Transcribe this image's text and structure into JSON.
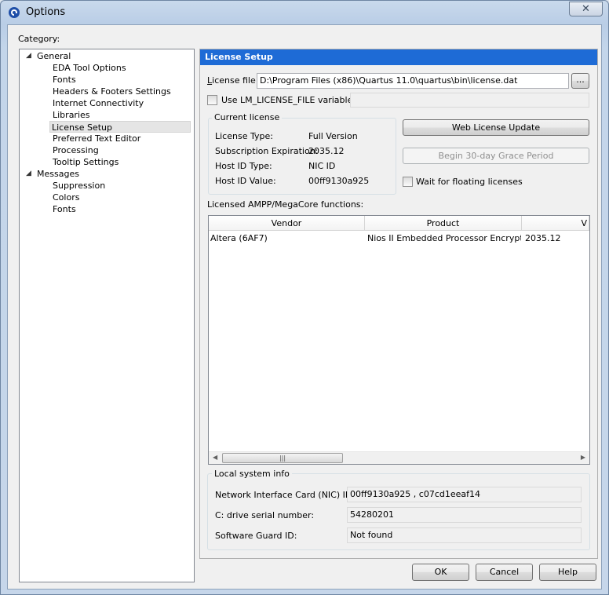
{
  "window": {
    "title": "Options",
    "close_glyph": "✕"
  },
  "category_label": "Category:",
  "tree": [
    {
      "label": "General",
      "expanded": true
    },
    {
      "label": "EDA Tool Options"
    },
    {
      "label": "Fonts"
    },
    {
      "label": "Headers & Footers Settings"
    },
    {
      "label": "Internet Connectivity"
    },
    {
      "label": "Libraries"
    },
    {
      "label": "License Setup",
      "selected": true
    },
    {
      "label": "Preferred Text Editor"
    },
    {
      "label": "Processing"
    },
    {
      "label": "Tooltip Settings"
    },
    {
      "label": "Messages",
      "expanded": true
    },
    {
      "label": "Suppression"
    },
    {
      "label": "Colors"
    },
    {
      "label": "Fonts"
    }
  ],
  "panel": {
    "header": "License Setup",
    "license_file_label_first": "L",
    "license_file_label_rest": "icense file:",
    "license_file_value": "D:\\Program Files (x86)\\Quartus 11.0\\quartus\\bin\\license.dat",
    "browse_label": "...",
    "use_lm_label": "Use LM_LICENSE_FILE variable:",
    "use_lm_value": "",
    "current_license": {
      "title": "Current license",
      "rows": [
        {
          "label": "License Type:",
          "value": "Full Version"
        },
        {
          "label": "Subscription Expiration:",
          "value": "2035.12"
        },
        {
          "label": "Host ID Type:",
          "value": "NIC ID"
        },
        {
          "label": "Host ID Value:",
          "value": "00ff9130a925"
        }
      ]
    },
    "web_license_update": "Web License Update",
    "grace_period": "Begin 30-day Grace Period",
    "wait_floating": "Wait for floating licenses",
    "ampp_label": "Licensed AMPP/MegaCore functions:",
    "ampp_columns": [
      "Vendor",
      "Product",
      "V"
    ],
    "ampp_rows": [
      {
        "vendor": "Altera (6AF7)",
        "product": "Nios II Embedded Processor Encrypte...",
        "version": "2035.12"
      }
    ],
    "scroll_left": "◀",
    "scroll_right": "▶",
    "scroll_grip": "|||",
    "local_info": {
      "title": "Local system info",
      "rows": [
        {
          "label": "Network Interface Card (NIC) ID:",
          "value": "00ff9130a925 , c07cd1eeaf14"
        },
        {
          "label": "C: drive serial number:",
          "value": "54280201"
        },
        {
          "label": "Software Guard ID:",
          "value": "Not found"
        }
      ]
    }
  },
  "buttons": {
    "ok": "OK",
    "cancel": "Cancel",
    "help": "Help"
  },
  "colors": {
    "header_blue": "#1e6bd6",
    "title_bar": "#c3d5ea"
  }
}
